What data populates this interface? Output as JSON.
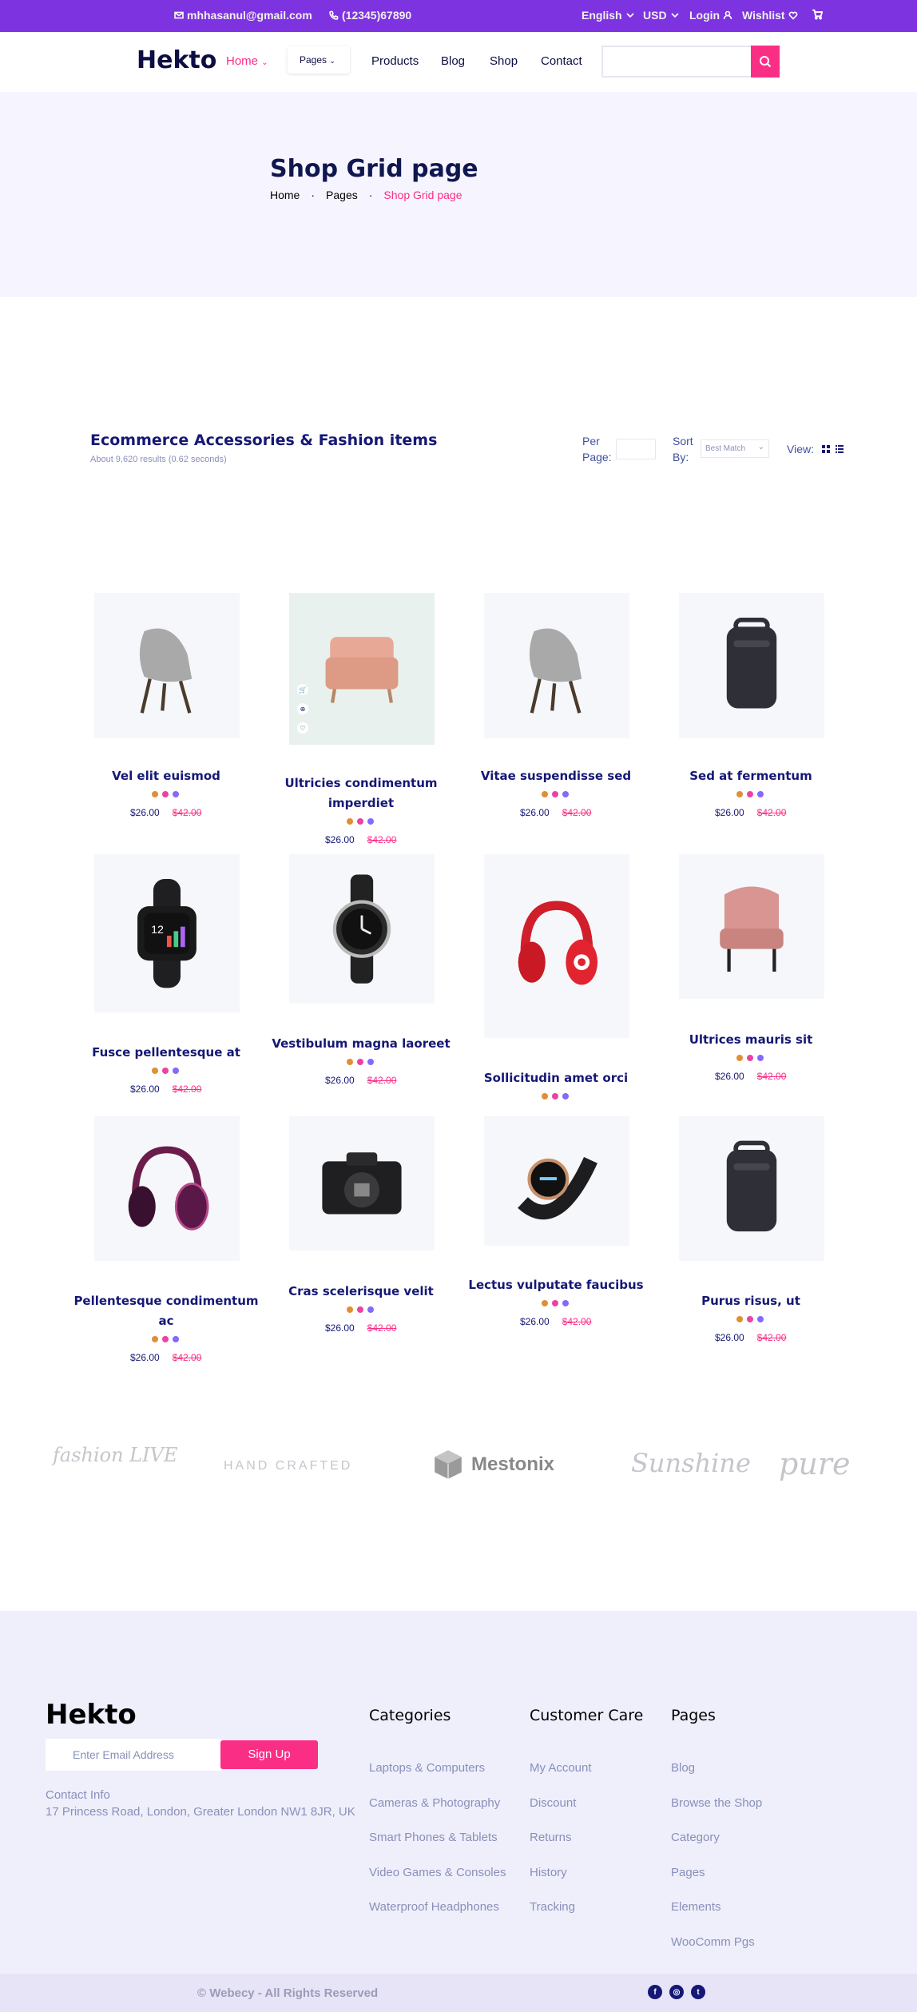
{
  "topbar": {
    "email": "mhhasanul@gmail.com",
    "phone": "(12345)67890",
    "language": "English",
    "currency": "USD",
    "login": "Login",
    "wishlist": "Wishlist"
  },
  "nav": {
    "logo": "Hekto",
    "home": "Home",
    "pages": "Pages",
    "products": "Products",
    "blog": "Blog",
    "shop": "Shop",
    "contact": "Contact",
    "search_placeholder": ""
  },
  "hero": {
    "title": "Shop Grid page",
    "crumbs": [
      "Home",
      "Pages",
      "Shop Grid page"
    ]
  },
  "toolbar": {
    "title": "Ecommerce Accessories & Fashion items",
    "subtitle": "About 9,620 results (0.62 seconds)",
    "per_page_label": "Per Page:",
    "per_page_value": "",
    "sort_label": "Sort By:",
    "sort_value": "Best Match",
    "view_label": "View:"
  },
  "colors": {
    "dots": [
      "#de9034",
      "#ec42a2",
      "#8568ff"
    ],
    "accent": "#fb2e86",
    "topbar": "#7e33e0"
  },
  "products": [
    {
      "name": "Vel elit euismod",
      "price": "$26.00",
      "old_price": "$42.00",
      "icon": "lounge-chair-icon"
    },
    {
      "name": "Ultricies condimentum imperdiet",
      "price": "$26.00",
      "old_price": "$42.00",
      "icon": "armchair-icon"
    },
    {
      "name": "Vitae suspendisse sed",
      "price": "$26.00",
      "old_price": "$42.00",
      "icon": "lounge-chair-icon"
    },
    {
      "name": "Sed at fermentum",
      "price": "$26.00",
      "old_price": "$42.00",
      "icon": "backpack-icon"
    },
    {
      "name": "Fusce pellentesque at",
      "price": "$26.00",
      "old_price": "$42.00",
      "icon": "smartwatch-icon"
    },
    {
      "name": "Vestibulum magna laoreet",
      "price": "$26.00",
      "old_price": "$42.00",
      "icon": "round-watch-icon"
    },
    {
      "name": "Sollicitudin amet orci",
      "price": "",
      "old_price": "",
      "icon": "red-headphones-icon"
    },
    {
      "name": "Ultrices mauris sit",
      "price": "$26.00",
      "old_price": "$42.00",
      "icon": "wingback-chair-icon"
    },
    {
      "name": "Pellentesque condimentum ac",
      "price": "$26.00",
      "old_price": "$42.00",
      "icon": "purple-headphones-icon"
    },
    {
      "name": "Cras scelerisque velit",
      "price": "$26.00",
      "old_price": "$42.00",
      "icon": "camera-icon"
    },
    {
      "name": "Lectus vulputate faucibus",
      "price": "$26.00",
      "old_price": "$42.00",
      "icon": "fitness-band-icon"
    },
    {
      "name": "Purus risus, ut",
      "price": "$26.00",
      "old_price": "$42.00",
      "icon": "backpack-icon"
    }
  ],
  "brands": [
    "fashion LIVE",
    "HAND CRAFTED",
    "Mestonix",
    "Sunshine",
    "pure"
  ],
  "footer": {
    "logo": "Hekto",
    "email_placeholder": "Enter Email Address",
    "signup": "Sign Up",
    "contact_title": "Contact Info",
    "address": "17 Princess Road, London, Greater London NW1 8JR, UK",
    "categories": {
      "title": "Categories",
      "items": [
        "Laptops & Computers",
        "Cameras & Photography",
        "Smart Phones & Tablets",
        "Video Games & Consoles",
        "Waterproof Headphones"
      ]
    },
    "care": {
      "title": "Customer Care",
      "items": [
        "My Account",
        "Discount",
        "Returns",
        "History",
        "Tracking"
      ]
    },
    "pages": {
      "title": "Pages",
      "items": [
        "Blog",
        "Browse the Shop",
        "Category",
        "Pages",
        "Elements",
        "WooComm Pgs"
      ]
    },
    "copyright": "© Webecy - All Rights Reserved",
    "social": [
      "facebook-icon",
      "instagram-icon",
      "twitter-icon"
    ]
  }
}
